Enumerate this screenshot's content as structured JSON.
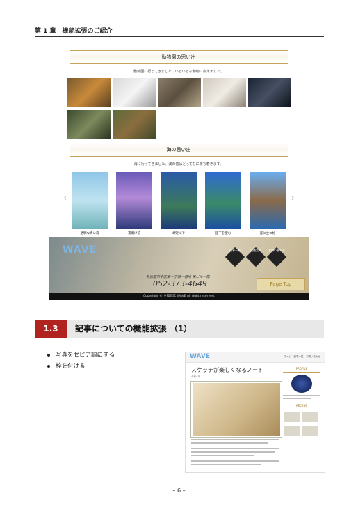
{
  "chapter_header": "第 1 章　機能拡張のご紹介",
  "screenshot1": {
    "zoo_title": "動物園の思い出",
    "zoo_caption": "動物園に行ってきました。いろいろな動物に会えました。",
    "sea_title": "海の思い出",
    "sea_caption": "海に行ってきました。波の音はとってもに落ち着きます。",
    "slider_labels": [
      "透明な青い海",
      "夜明け前",
      "岬近くで",
      "崖下を望む",
      "崖に立つ松"
    ],
    "prev_arrow": "‹",
    "next_arrow": "›"
  },
  "footer_shot": {
    "logo": "WAVE",
    "nav": [
      "記事一覧",
      "交通案内",
      "お問い合わせ"
    ],
    "address": "名古屋市中区栄一丁目一番地 栄ビル一階",
    "phone": "052-373-4649",
    "pagetop": "Page Top",
    "copyright": "Copyright © 令和四年 WAVE All right reserved."
  },
  "section": {
    "number": "1.3",
    "title": "記事についての機能拡張 （1）"
  },
  "bullets": [
    "写真をセピア調にする",
    "枠を付ける"
  ],
  "screenshot2": {
    "logo": "WAVE",
    "nav_text": "ホーム　記事一覧　お問い合わせ",
    "article_title": "スケッチが楽しくなるノート",
    "date": "令和4年",
    "sidebar_head1": "PROFILE",
    "sidebar_head2": "RECENT"
  },
  "page_number": "– 6 –",
  "colors": {
    "section_accent": "#b0231f",
    "banner_gold": "#c8a45a"
  }
}
